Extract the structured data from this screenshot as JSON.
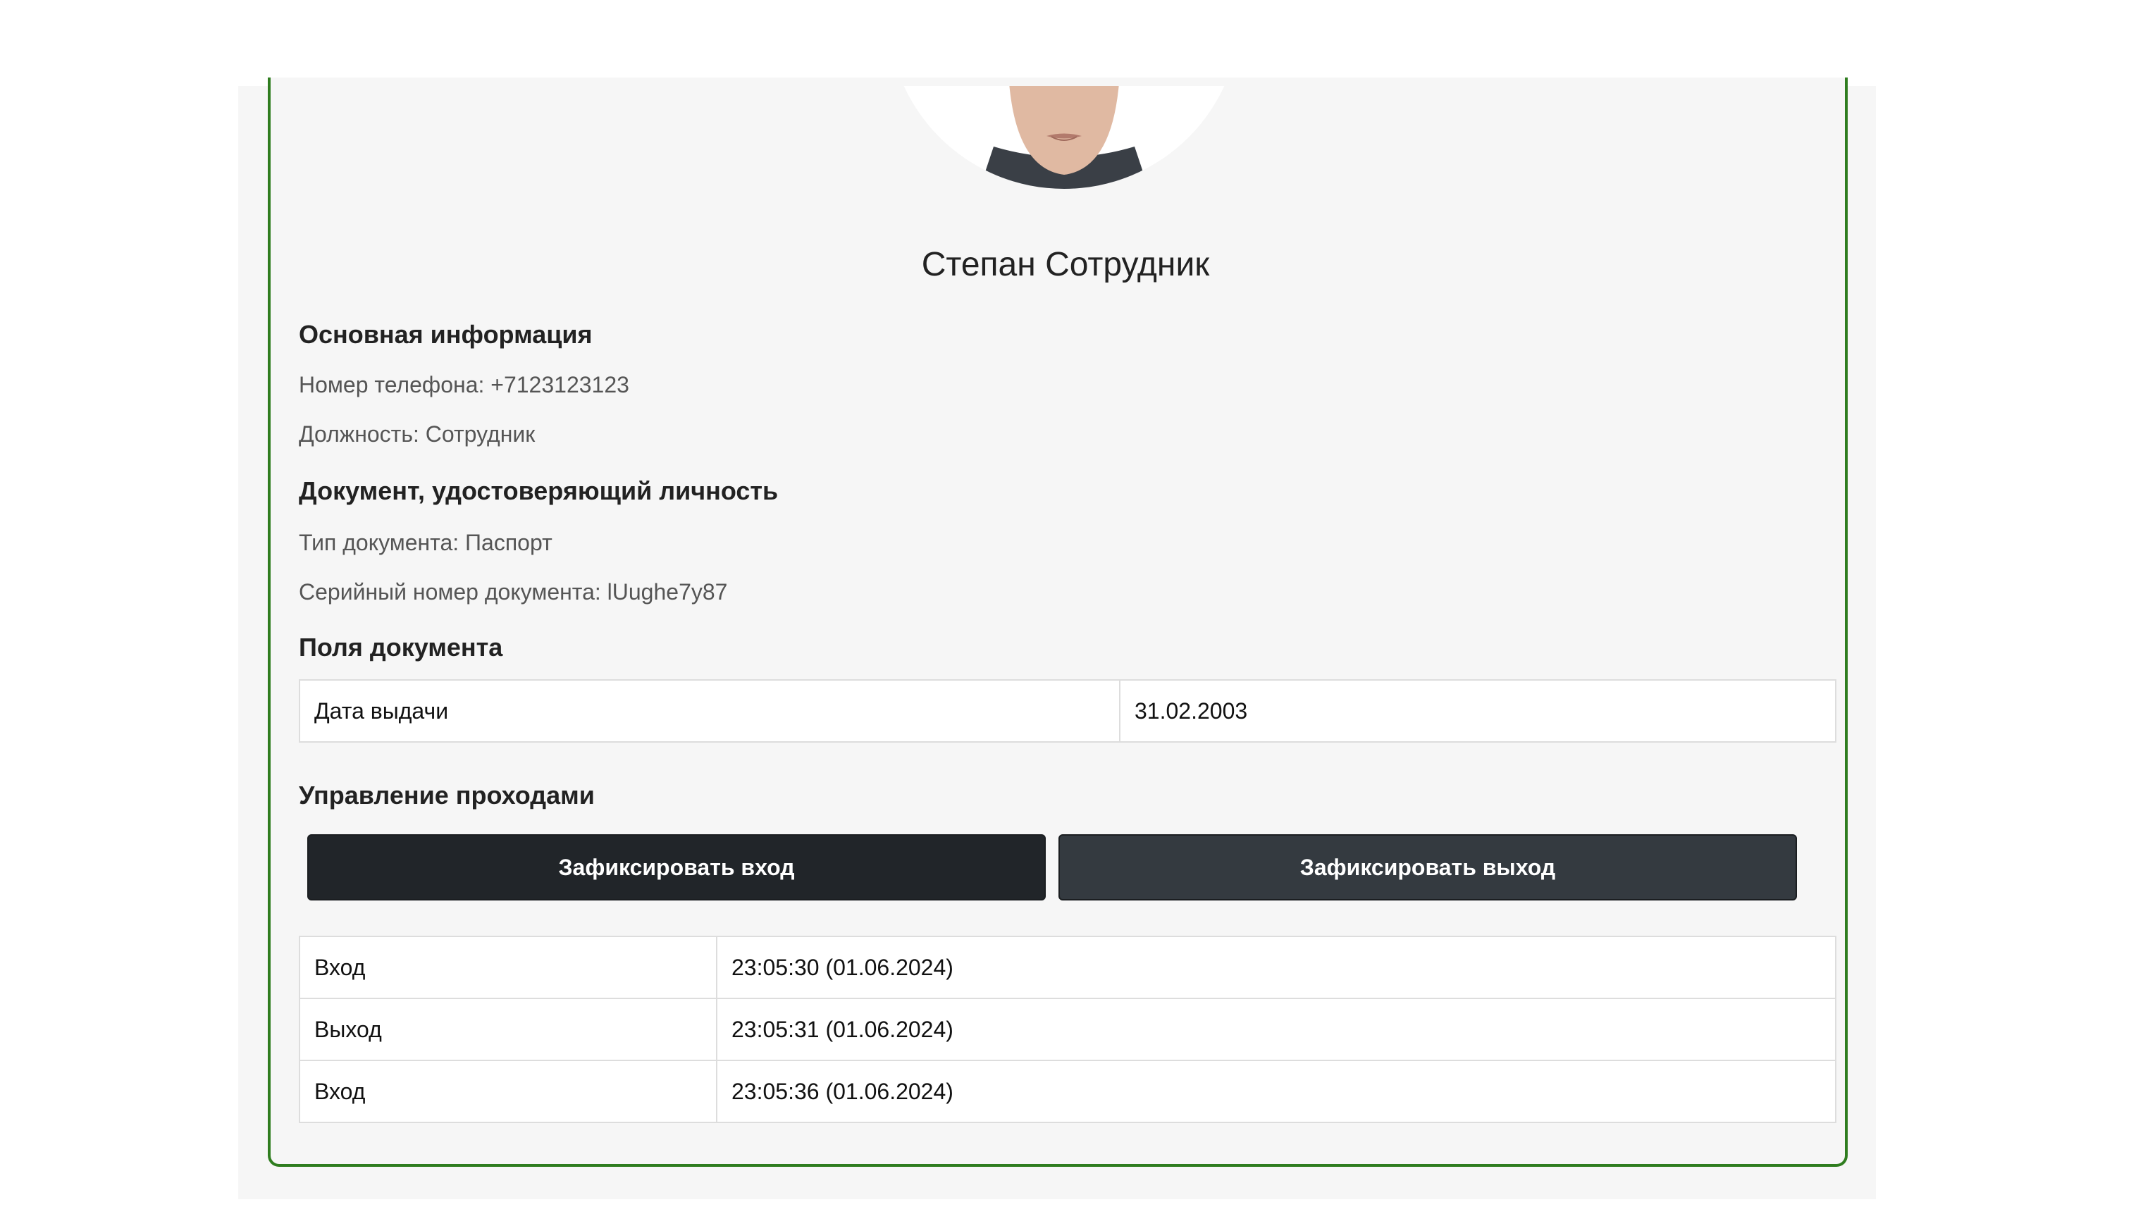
{
  "employee": {
    "name": "Степан Сотрудник"
  },
  "sections": {
    "basic_info": "Основная информация",
    "phone": "Номер телефона: +7123123123",
    "position": "Должность: Сотрудник",
    "id_document": "Документ, удостоверяющий личность",
    "doc_type": "Тип документа: Паспорт",
    "doc_serial": "Серийный номер документа: lUughe7y87",
    "doc_fields": "Поля документа",
    "access_control": "Управление проходами"
  },
  "doc_fields_table": [
    {
      "label": "Дата выдачи",
      "value": "31.02.2003"
    }
  ],
  "buttons": {
    "check_in": "Зафиксировать вход",
    "check_out": "Зафиксировать выход"
  },
  "access_log": [
    {
      "type": "Вход",
      "time": "23:05:30 (01.06.2024)"
    },
    {
      "type": "Выход",
      "time": "23:05:31 (01.06.2024)"
    },
    {
      "type": "Вход",
      "time": "23:05:36 (01.06.2024)"
    }
  ],
  "colors": {
    "card_border": "#2f7d1f",
    "check_in_button": "#212529",
    "check_out_button": "#343a40"
  }
}
